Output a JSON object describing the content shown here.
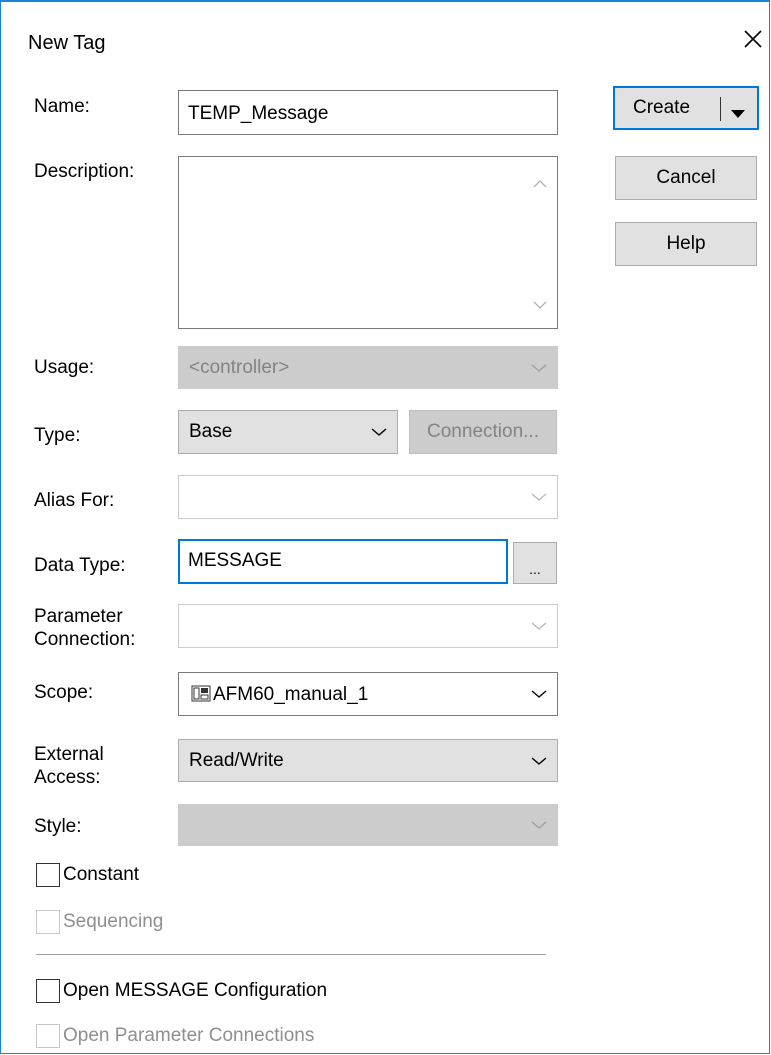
{
  "dialog": {
    "title": "New Tag",
    "close_icon": "close-icon"
  },
  "labels": {
    "name": "Name:",
    "description": "Description:",
    "usage": "Usage:",
    "type": "Type:",
    "alias_for": "Alias For:",
    "data_type": "Data Type:",
    "parameter_connection_1": "Parameter",
    "parameter_connection_2": "Connection:",
    "scope": "Scope:",
    "external_access_1": "External",
    "external_access_2": "Access:",
    "style": "Style:"
  },
  "fields": {
    "name_value": "TEMP_Message",
    "description_value": "",
    "usage_value": "<controller>",
    "type_value": "Base",
    "alias_for_value": "",
    "data_type_value": "MESSAGE",
    "parameter_connection_value": "",
    "scope_value": "AFM60_manual_1",
    "external_access_value": "Read/Write",
    "style_value": ""
  },
  "buttons": {
    "create": "Create",
    "cancel": "Cancel",
    "help": "Help",
    "connection": "Connection...",
    "browse": "..."
  },
  "checkboxes": {
    "constant": "Constant",
    "sequencing": "Sequencing",
    "open_message_config": "Open MESSAGE Configuration",
    "open_param_connections": "Open Parameter Connections"
  },
  "colors": {
    "accent": "#0078d7",
    "disabled_bg": "#cccccc",
    "button_bg": "#e1e1e1"
  }
}
